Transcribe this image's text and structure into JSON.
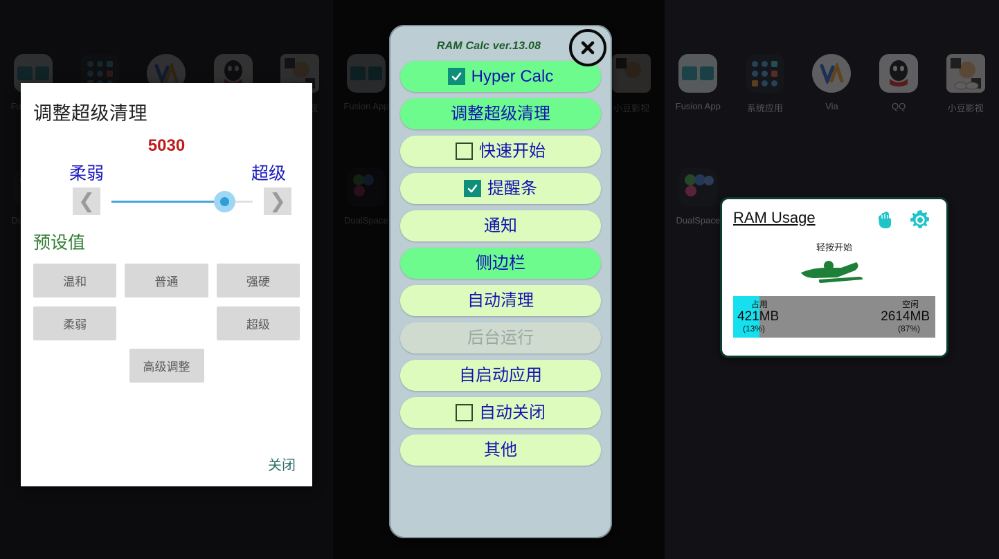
{
  "home_screen": {
    "apps_row1": [
      {
        "label": "Fusion App",
        "icon": "fusion-app-icon"
      },
      {
        "label": "系统应用",
        "icon": "system-apps-folder-icon"
      },
      {
        "label": "Via",
        "icon": "via-browser-icon"
      },
      {
        "label": "QQ",
        "icon": "qq-icon"
      },
      {
        "label": "小豆影视",
        "icon": "xiaodou-video-icon"
      }
    ],
    "apps_row2": [
      {
        "label": "DualSpace",
        "icon": "dualspace-icon"
      }
    ]
  },
  "tune_dialog": {
    "title": "调整超级清理",
    "value": "5030",
    "slider": {
      "left_label": "柔弱",
      "right_label": "超级",
      "percent": 80,
      "prev_arrow": "❮",
      "next_arrow": "❯"
    },
    "preset_heading": "预设值",
    "presets": [
      "温和",
      "普通",
      "强硬",
      "柔弱",
      "",
      "超级"
    ],
    "advanced_label": "高级调整",
    "close_label": "关闭"
  },
  "ramcalc_sheet": {
    "title": "RAM Calc ver.13.08",
    "close_icon": "close-x-icon",
    "menu_items": [
      {
        "label": "Hyper Calc",
        "tone": "bright",
        "check": "checked"
      },
      {
        "label": "调整超级清理",
        "tone": "bright",
        "check": "none"
      },
      {
        "label": "快速开始",
        "tone": "pale",
        "check": "unchecked"
      },
      {
        "label": "提醒条",
        "tone": "pale",
        "check": "checked"
      },
      {
        "label": "通知",
        "tone": "pale",
        "check": "none"
      },
      {
        "label": "侧边栏",
        "tone": "bright",
        "check": "none"
      },
      {
        "label": "自动清理",
        "tone": "pale",
        "check": "none"
      },
      {
        "label": "后台运行",
        "tone": "off",
        "check": "none"
      },
      {
        "label": "自启动应用",
        "tone": "pale",
        "check": "none"
      },
      {
        "label": "自动关闭",
        "tone": "pale",
        "check": "unchecked"
      },
      {
        "label": "其他",
        "tone": "pale",
        "check": "none"
      }
    ]
  },
  "ram_widget": {
    "title": "RAM Usage",
    "fist_icon": "fist-icon",
    "gear_icon": "gear-icon",
    "hint": "轻按开始",
    "figure_icon": "sledding-figure-icon",
    "used": {
      "caption": "占用",
      "amount": "421MB",
      "percent_label": "(13%)",
      "percent": 13
    },
    "free": {
      "caption": "空闲",
      "amount": "2614MB",
      "percent_label": "(87%)",
      "percent": 87
    }
  },
  "colors": {
    "accent_cyan": "#17e0ee",
    "value_red": "#c11b1b",
    "slider_blue": "#43a5dd",
    "menu_blue_text": "#1414b4",
    "pill_bright": "#6dfb8d",
    "pill_pale": "#dcfbbc",
    "sheet_bg": "#bccdd3",
    "preset_green": "#2f7d32"
  }
}
